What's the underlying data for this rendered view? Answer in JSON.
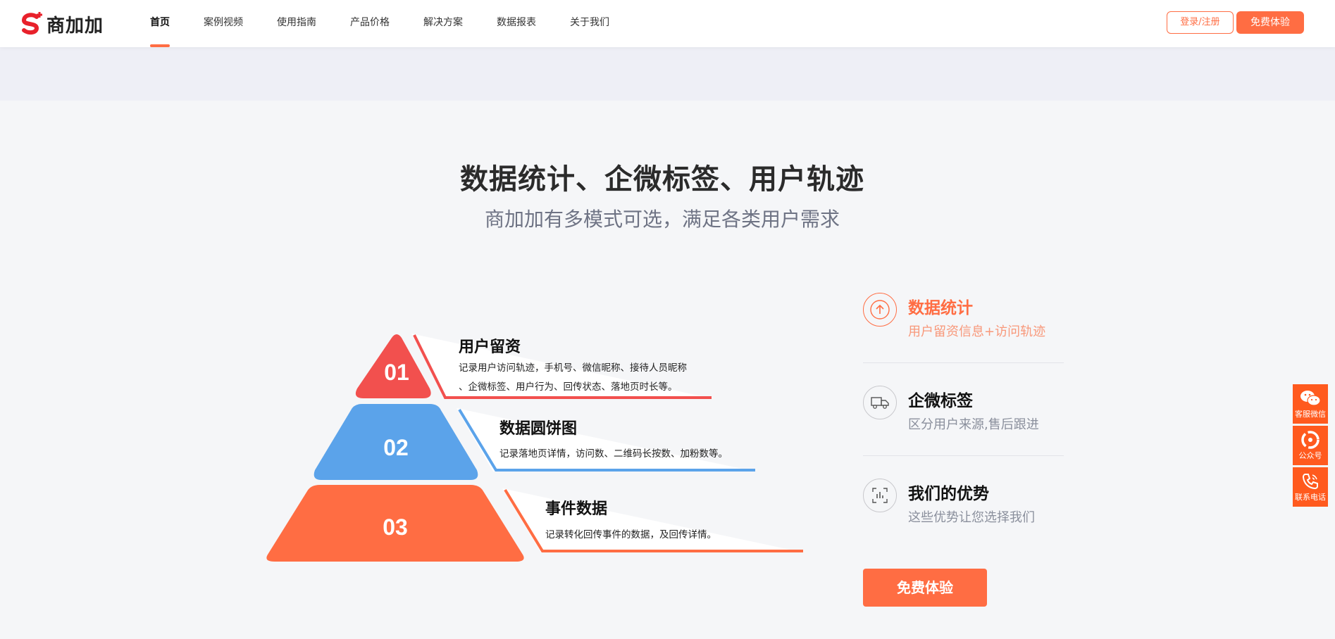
{
  "logo": {
    "text": "商加加"
  },
  "nav": {
    "items": [
      {
        "label": "首页",
        "active": true
      },
      {
        "label": "案例视频"
      },
      {
        "label": "使用指南"
      },
      {
        "label": "产品价格"
      },
      {
        "label": "解决方案"
      },
      {
        "label": "数据报表"
      },
      {
        "label": "关于我们"
      }
    ]
  },
  "header": {
    "login_label": "登录/注册",
    "try_label": "免费体验"
  },
  "hero": {
    "title": "数据统计、企微标签、用户轨迹",
    "subtitle": "商加加有多模式可选，满足各类用户需求"
  },
  "pyramid": [
    {
      "num": "01",
      "title": "用户留资",
      "desc1": "记录用户访问轨迹，手机号、微信昵称、接待人员昵称",
      "desc2": "、企微标签、用户行为、回传状态、落地页时长等。",
      "color": "#f2504e"
    },
    {
      "num": "02",
      "title": "数据圆饼图",
      "desc1": "记录落地页详情，访问数、二维码长按数、加粉数等。",
      "color": "#5ba3ea"
    },
    {
      "num": "03",
      "title": "事件数据",
      "desc1": "记录转化回传事件的数据，及回传详情。",
      "color": "#ff6d43"
    }
  ],
  "features": [
    {
      "title": "数据统计",
      "sub": "用户留资信息+访问轨迹",
      "icon": "upload-icon",
      "active": true
    },
    {
      "title": "企微标签",
      "sub": "区分用户来源,售后跟进",
      "icon": "truck-icon"
    },
    {
      "title": "我们的优势",
      "sub": "这些优势让您选择我们",
      "icon": "chart-icon"
    }
  ],
  "cta": {
    "label": "免费体验"
  },
  "sidebar": {
    "items": [
      {
        "label": "客服微信",
        "icon": "wechat-icon"
      },
      {
        "label": "公众号",
        "icon": "official-account-icon"
      },
      {
        "label": "联系电话",
        "icon": "phone-icon"
      }
    ]
  },
  "colors": {
    "accent": "#ff6d43",
    "red": "#f2504e",
    "blue": "#5ba3ea",
    "side": "#ff5a1e"
  }
}
